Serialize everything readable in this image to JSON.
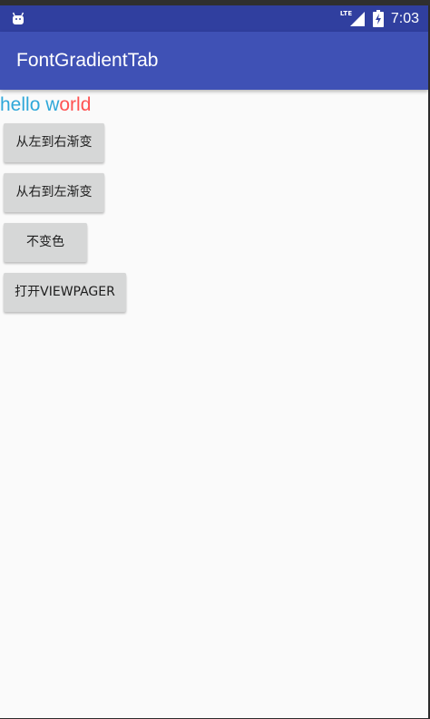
{
  "status_bar": {
    "network_badge": "LTE",
    "time": "7:03",
    "left_icon": "android-icon",
    "signal_icon": "cell-signal-icon",
    "battery_icon": "battery-charging-icon"
  },
  "app_bar": {
    "title": "FontGradientTab",
    "background_color": "#3f51b5",
    "status_color": "#303f9f"
  },
  "content": {
    "hello_text_part1": "hello w",
    "hello_text_part2": "orld",
    "hello_color_part1": "#2ea7d9",
    "hello_color_part2": "#ff5252"
  },
  "buttons": [
    {
      "label": "从左到右渐变"
    },
    {
      "label": "从右到左渐变"
    },
    {
      "label": "不变色"
    },
    {
      "label": "打开VIEWPAGER"
    }
  ]
}
